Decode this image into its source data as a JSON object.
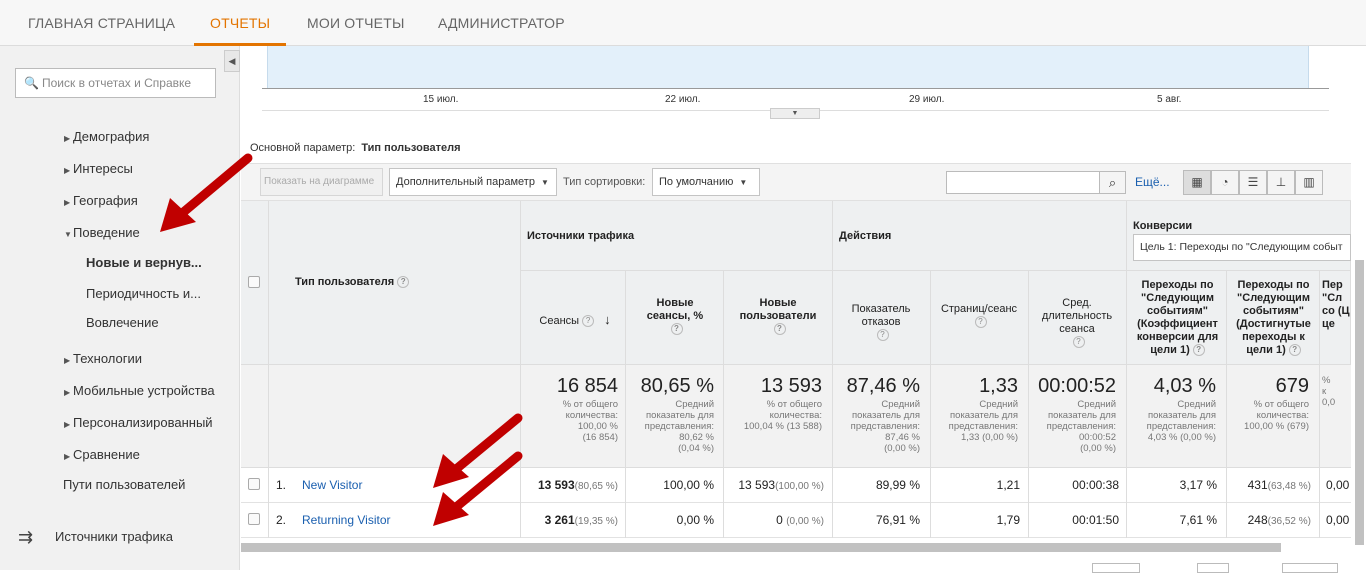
{
  "topnav": {
    "tabs": [
      "ГЛАВНАЯ СТРАНИЦА",
      "ОТЧЕТЫ",
      "МОИ ОТЧЕТЫ",
      "АДМИНИСТРАТОР"
    ],
    "active_index": 1
  },
  "sidebar": {
    "search_placeholder": "Поиск в отчетах и Справке",
    "items": [
      {
        "label": "Демография",
        "expandable": true
      },
      {
        "label": "Интересы",
        "expandable": true
      },
      {
        "label": "География",
        "expandable": true
      },
      {
        "label": "Поведение",
        "expanded": true
      },
      {
        "label": "Новые и вернув...",
        "selected": true
      },
      {
        "label": "Периодичность и..."
      },
      {
        "label": "Вовлечение"
      },
      {
        "label": "Технологии",
        "expandable": true
      },
      {
        "label": "Мобильные устройства",
        "expandable": true
      },
      {
        "label": "Персонализированный",
        "expandable": true
      },
      {
        "label": "Сравнение",
        "expandable": true
      },
      {
        "label": "Пути пользователей"
      }
    ],
    "section": "Источники трафика"
  },
  "graph": {
    "dates": [
      "15 июл.",
      "22 июл.",
      "29 июл.",
      "5 авг."
    ]
  },
  "primary_dimension": {
    "label": "Основной параметр:",
    "value": "Тип пользователя"
  },
  "toolbar": {
    "plot_button": "Показать на диаграмме",
    "secondary_dimension": "Дополнительный параметр",
    "sort_label": "Тип сортировки:",
    "sort_value": "По умолчанию",
    "more_link": "Ещё..."
  },
  "table": {
    "dimension_header": "Тип пользователя",
    "groups": {
      "acquisition": "Источники трафика",
      "behavior": "Действия",
      "conversions": "Конверсии",
      "goal_select": "Цель 1: Переходы по \"Следующим событ"
    },
    "columns": [
      "Сеансы",
      "Новые сеансы, %",
      "Новые пользователи",
      "Показатель отказов",
      "Страниц/сеанс",
      "Сред. длительность сеанса",
      "Переходы по \"Следующим событиям\" (Коэффициент конверсии для цели 1)",
      "Переходы по \"Следующим событиям\" (Достигнутые переходы к цели 1)",
      "Пер \"Сл со (Ц це"
    ],
    "totals": [
      {
        "value": "16 854",
        "sub": [
          "% от общего",
          "количества:",
          "100,00 %",
          "(16 854)"
        ]
      },
      {
        "value": "80,65 %",
        "sub": [
          "Средний",
          "показатель для",
          "представления:",
          "80,62 %",
          "(0,04 %)"
        ]
      },
      {
        "value": "13 593",
        "sub": [
          "% от общего",
          "количества:",
          "100,04 % (13 588)"
        ]
      },
      {
        "value": "87,46 %",
        "sub": [
          "Средний",
          "показатель для",
          "представления:",
          "87,46 %",
          "(0,00 %)"
        ]
      },
      {
        "value": "1,33",
        "sub": [
          "Средний",
          "показатель для",
          "представления:",
          "1,33 (0,00 %)"
        ]
      },
      {
        "value": "00:00:52",
        "sub": [
          "Средний",
          "показатель для",
          "представления:",
          "00:00:52",
          "(0,00 %)"
        ]
      },
      {
        "value": "4,03 %",
        "sub": [
          "Средний",
          "показатель для",
          "представления:",
          "4,03 % (0,00 %)"
        ]
      },
      {
        "value": "679",
        "sub": [
          "% от общего",
          "количества:",
          "100,00 % (679)"
        ]
      },
      {
        "value": "",
        "sub": [
          "%",
          "к",
          "0,0"
        ]
      }
    ],
    "rows": [
      {
        "index": "1.",
        "name": "New Visitor",
        "sessions": "13 593",
        "sessions_pct": "(80,65 %)",
        "new_sessions": "100,00 %",
        "new_users": "13 593",
        "new_users_pct": "(100,00 %)",
        "bounce": "89,99 %",
        "pages": "1,21",
        "duration": "00:00:38",
        "conv_rate": "3,17 %",
        "goal": "431",
        "goal_pct": "(63,48 %)",
        "cut": "0,00"
      },
      {
        "index": "2.",
        "name": "Returning Visitor",
        "sessions": "3 261",
        "sessions_pct": "(19,35 %)",
        "new_sessions": "0,00 %",
        "new_users": "0",
        "new_users_pct": "(0,00 %)",
        "bounce": "76,91 %",
        "pages": "1,79",
        "duration": "00:01:50",
        "conv_rate": "7,61 %",
        "goal": "248",
        "goal_pct": "(36,52 %)",
        "cut": "0,00"
      }
    ]
  },
  "colors": {
    "accent": "#e37400",
    "link": "#1a5faf",
    "arrow": "#c00000"
  }
}
